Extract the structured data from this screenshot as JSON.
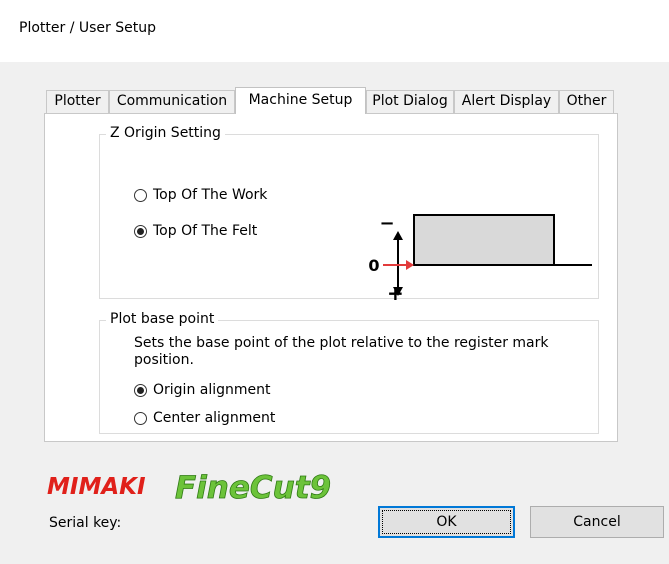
{
  "window": {
    "title": "Plotter / User Setup"
  },
  "tabs": [
    {
      "label": "Plotter"
    },
    {
      "label": "Communication"
    },
    {
      "label": "Machine Setup",
      "active": true
    },
    {
      "label": "Plot Dialog"
    },
    {
      "label": "Alert Display"
    },
    {
      "label": "Other"
    }
  ],
  "z_origin": {
    "legend": "Z Origin Setting",
    "options": [
      {
        "label": "Top Of The Work",
        "selected": false
      },
      {
        "label": "Top Of The Felt",
        "selected": true
      }
    ],
    "diagram": {
      "minus": "−",
      "zero": "0",
      "plus": "+"
    }
  },
  "plot_base": {
    "legend": "Plot base point",
    "description": "Sets the base point of the plot relative to the register mark position.",
    "options": [
      {
        "label": "Origin alignment",
        "selected": true
      },
      {
        "label": "Center alignment",
        "selected": false
      }
    ]
  },
  "logo": {
    "brand": "MIMAKI",
    "product": "FineCut9"
  },
  "serial": {
    "label": "Serial key:"
  },
  "buttons": {
    "ok": "OK",
    "cancel": "Cancel"
  },
  "colors": {
    "accent": "#0078d7",
    "mimaki_red": "#e0201a",
    "finecut_green": "#6cc33a",
    "arrow_red": "#e23b3b"
  }
}
